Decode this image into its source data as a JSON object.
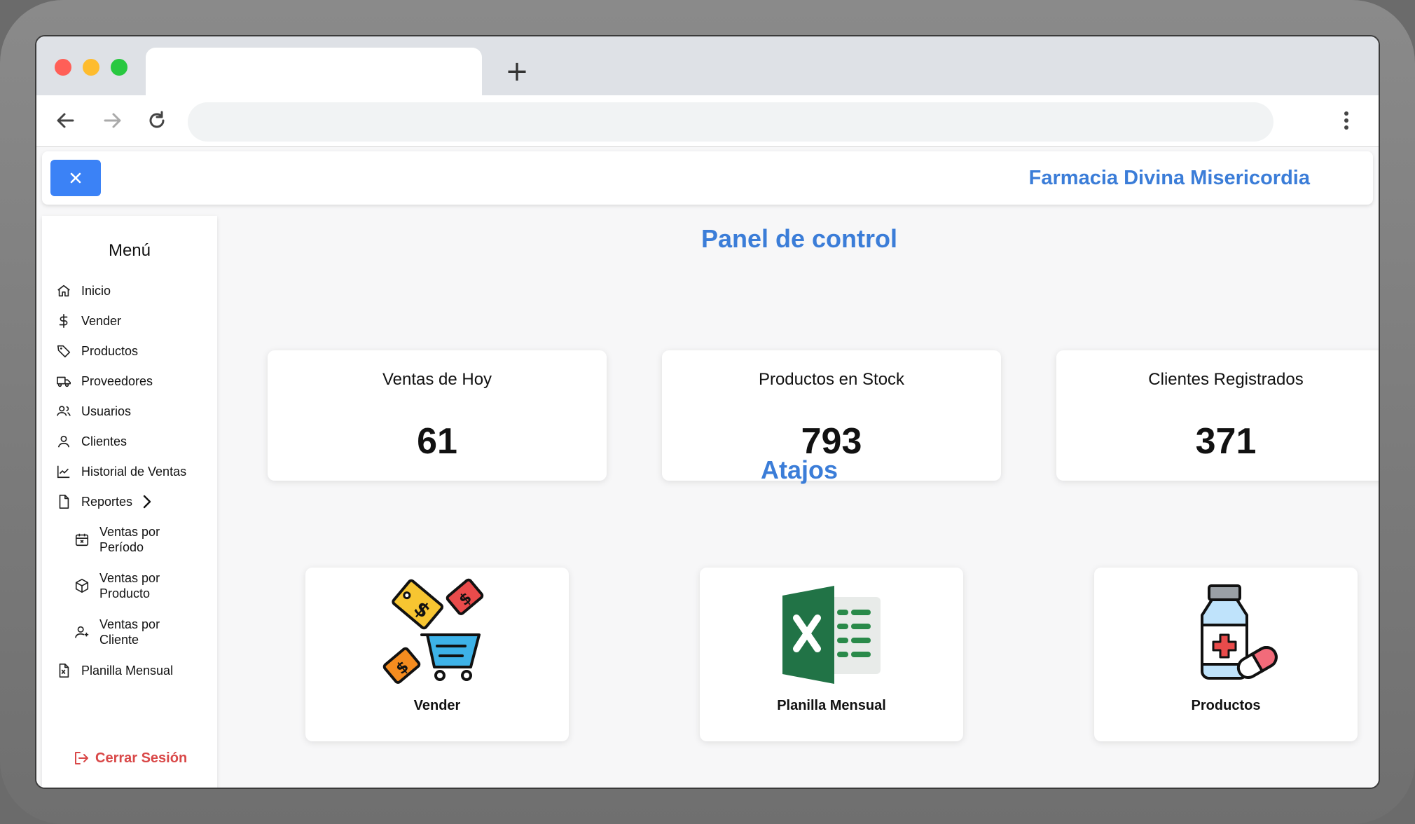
{
  "browser": {
    "new_tab_glyph": "+"
  },
  "header": {
    "brand": "Farmacia Divina Misericordia"
  },
  "sidebar": {
    "title": "Menú",
    "items": [
      {
        "label": "Inicio",
        "icon": "home-icon"
      },
      {
        "label": "Vender",
        "icon": "dollar-icon"
      },
      {
        "label": "Productos",
        "icon": "tag-icon"
      },
      {
        "label": "Proveedores",
        "icon": "truck-icon"
      },
      {
        "label": "Usuarios",
        "icon": "users-icon"
      },
      {
        "label": "Clientes",
        "icon": "user-icon"
      },
      {
        "label": "Historial de Ventas",
        "icon": "chart-line-icon"
      },
      {
        "label": "Reportes",
        "icon": "file-icon"
      },
      {
        "label": "Ventas por Período",
        "icon": "calendar-x-icon"
      },
      {
        "label": "Ventas por Producto",
        "icon": "box-icon"
      },
      {
        "label": "Ventas por Cliente",
        "icon": "user-plus-icon"
      },
      {
        "label": "Planilla Mensual",
        "icon": "excel-file-icon"
      }
    ],
    "logout": "Cerrar Sesión"
  },
  "main": {
    "title": "Panel de control",
    "stats": [
      {
        "label": "Ventas de Hoy",
        "value": "61"
      },
      {
        "label": "Productos en Stock",
        "value": "793"
      },
      {
        "label": "Clientes Registrados",
        "value": "371"
      }
    ],
    "shortcuts_title": "Atajos",
    "shortcuts": [
      {
        "label": "Vender",
        "icon": "shopping-cart-tags-icon"
      },
      {
        "label": "Planilla Mensual",
        "icon": "excel-icon"
      },
      {
        "label": "Productos",
        "icon": "medicine-bottle-icon"
      }
    ]
  },
  "colors": {
    "accent": "#3b7dd8",
    "button": "#3b82f6",
    "logout": "#d94848"
  }
}
